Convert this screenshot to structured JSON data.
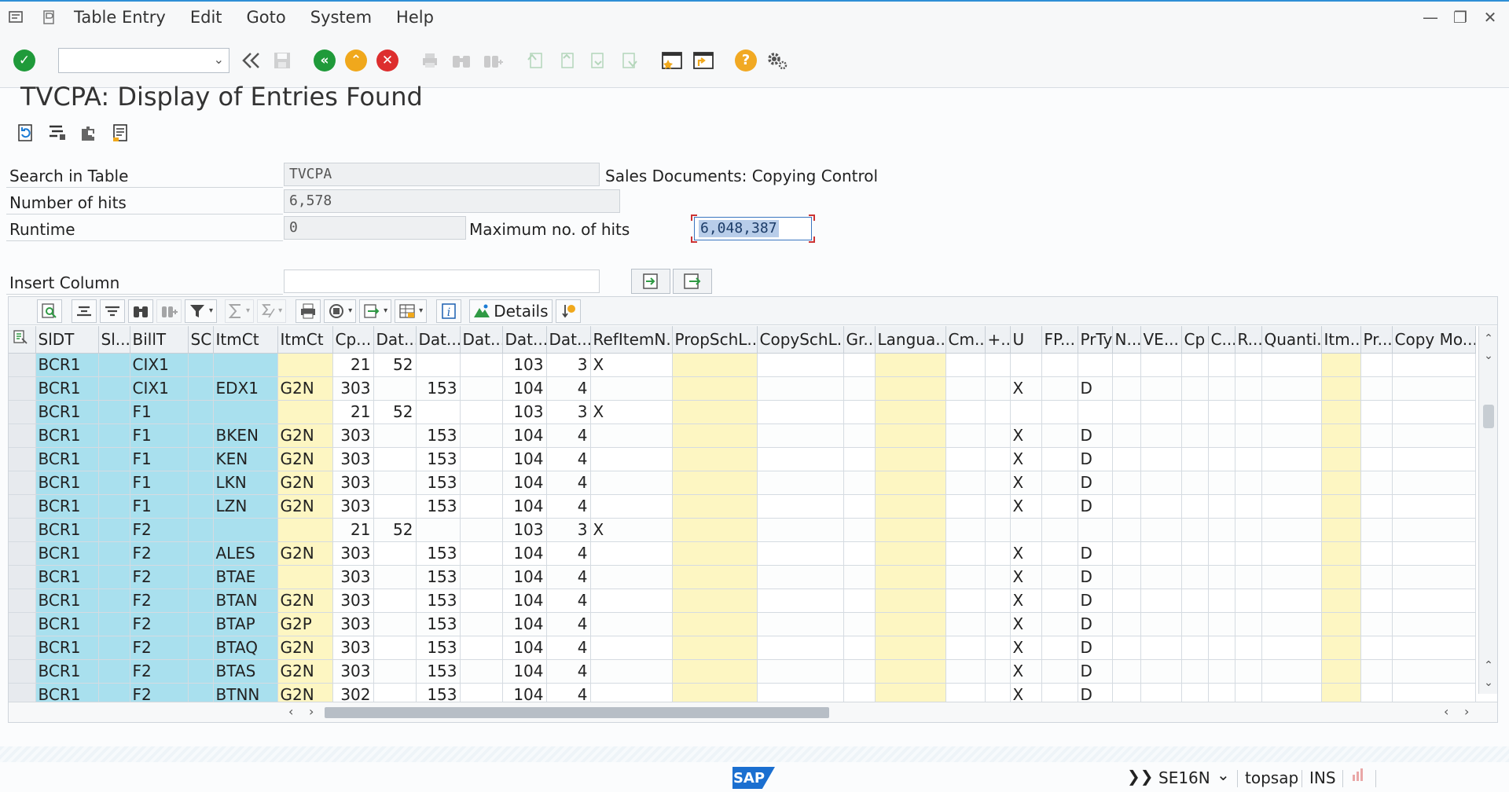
{
  "menu": {
    "items": [
      "Table Entry",
      "Edit",
      "Goto",
      "System",
      "Help"
    ],
    "window_controls": [
      "—",
      "❐",
      "✕"
    ]
  },
  "toolbar": {
    "command_field_value": ""
  },
  "page_title": "TVCPA: Display of Entries Found",
  "form": {
    "search_in_table_label": "Search in Table",
    "search_in_table_value": "TVCPA",
    "search_in_table_desc": "Sales Documents: Copying Control",
    "number_of_hits_label": "Number of hits",
    "number_of_hits_value": "6,578",
    "runtime_label": "Runtime",
    "runtime_value": "0",
    "max_hits_label": "Maximum no. of hits",
    "max_hits_value": "6,048,387",
    "insert_column_label": "Insert Column",
    "insert_column_value": ""
  },
  "alv": {
    "details_label": "Details"
  },
  "grid": {
    "columns": [
      "SlDT",
      "Sl...",
      "BillT",
      "SC",
      "ItmCt",
      "ItmCt",
      "Cp...",
      "Dat...",
      "Dat...",
      "Dat...",
      "Dat...",
      "Dat...",
      "RefItemN...",
      "PropSchL...",
      "CopySchL...",
      "Gr...",
      "Langua...",
      "Cm...",
      "+...",
      "U",
      "FP...",
      "PrTy",
      "N...",
      "VE...",
      "Cp",
      "C...",
      "R...",
      "Quanti...",
      "Itm...",
      "Pr...",
      "Copy Mo..."
    ],
    "rows": [
      [
        "BCR1",
        "",
        "CIX1",
        "",
        "",
        "",
        "21",
        "52",
        "",
        "",
        "103",
        "3",
        "X",
        "",
        "",
        "",
        "",
        "",
        "",
        "",
        "",
        "",
        "",
        "",
        "",
        "",
        "",
        "",
        "",
        "",
        ""
      ],
      [
        "BCR1",
        "",
        "CIX1",
        "",
        "EDX1",
        "G2N",
        "303",
        "",
        "153",
        "",
        "104",
        "4",
        "",
        "",
        "",
        "",
        "",
        "",
        "",
        "X",
        "",
        "D",
        "",
        "",
        "",
        "",
        "",
        "",
        "",
        "",
        ""
      ],
      [
        "BCR1",
        "",
        "F1",
        "",
        "",
        "",
        "21",
        "52",
        "",
        "",
        "103",
        "3",
        "X",
        "",
        "",
        "",
        "",
        "",
        "",
        "",
        "",
        "",
        "",
        "",
        "",
        "",
        "",
        "",
        "",
        "",
        ""
      ],
      [
        "BCR1",
        "",
        "F1",
        "",
        "BKEN",
        "G2N",
        "303",
        "",
        "153",
        "",
        "104",
        "4",
        "",
        "",
        "",
        "",
        "",
        "",
        "",
        "X",
        "",
        "D",
        "",
        "",
        "",
        "",
        "",
        "",
        "",
        "",
        ""
      ],
      [
        "BCR1",
        "",
        "F1",
        "",
        "KEN",
        "G2N",
        "303",
        "",
        "153",
        "",
        "104",
        "4",
        "",
        "",
        "",
        "",
        "",
        "",
        "",
        "X",
        "",
        "D",
        "",
        "",
        "",
        "",
        "",
        "",
        "",
        "",
        ""
      ],
      [
        "BCR1",
        "",
        "F1",
        "",
        "LKN",
        "G2N",
        "303",
        "",
        "153",
        "",
        "104",
        "4",
        "",
        "",
        "",
        "",
        "",
        "",
        "",
        "X",
        "",
        "D",
        "",
        "",
        "",
        "",
        "",
        "",
        "",
        "",
        ""
      ],
      [
        "BCR1",
        "",
        "F1",
        "",
        "LZN",
        "G2N",
        "303",
        "",
        "153",
        "",
        "104",
        "4",
        "",
        "",
        "",
        "",
        "",
        "",
        "",
        "X",
        "",
        "D",
        "",
        "",
        "",
        "",
        "",
        "",
        "",
        "",
        ""
      ],
      [
        "BCR1",
        "",
        "F2",
        "",
        "",
        "",
        "21",
        "52",
        "",
        "",
        "103",
        "3",
        "X",
        "",
        "",
        "",
        "",
        "",
        "",
        "",
        "",
        "",
        "",
        "",
        "",
        "",
        "",
        "",
        "",
        "",
        ""
      ],
      [
        "BCR1",
        "",
        "F2",
        "",
        "ALES",
        "G2N",
        "303",
        "",
        "153",
        "",
        "104",
        "4",
        "",
        "",
        "",
        "",
        "",
        "",
        "",
        "X",
        "",
        "D",
        "",
        "",
        "",
        "",
        "",
        "",
        "",
        "",
        ""
      ],
      [
        "BCR1",
        "",
        "F2",
        "",
        "BTAE",
        "",
        "303",
        "",
        "153",
        "",
        "104",
        "4",
        "",
        "",
        "",
        "",
        "",
        "",
        "",
        "X",
        "",
        "D",
        "",
        "",
        "",
        "",
        "",
        "",
        "",
        "",
        ""
      ],
      [
        "BCR1",
        "",
        "F2",
        "",
        "BTAN",
        "G2N",
        "303",
        "",
        "153",
        "",
        "104",
        "4",
        "",
        "",
        "",
        "",
        "",
        "",
        "",
        "X",
        "",
        "D",
        "",
        "",
        "",
        "",
        "",
        "",
        "",
        "",
        ""
      ],
      [
        "BCR1",
        "",
        "F2",
        "",
        "BTAP",
        "G2P",
        "303",
        "",
        "153",
        "",
        "104",
        "4",
        "",
        "",
        "",
        "",
        "",
        "",
        "",
        "X",
        "",
        "D",
        "",
        "",
        "",
        "",
        "",
        "",
        "",
        "",
        ""
      ],
      [
        "BCR1",
        "",
        "F2",
        "",
        "BTAQ",
        "G2N",
        "303",
        "",
        "153",
        "",
        "104",
        "4",
        "",
        "",
        "",
        "",
        "",
        "",
        "",
        "X",
        "",
        "D",
        "",
        "",
        "",
        "",
        "",
        "",
        "",
        "",
        ""
      ],
      [
        "BCR1",
        "",
        "F2",
        "",
        "BTAS",
        "G2N",
        "303",
        "",
        "153",
        "",
        "104",
        "4",
        "",
        "",
        "",
        "",
        "",
        "",
        "",
        "X",
        "",
        "D",
        "",
        "",
        "",
        "",
        "",
        "",
        "",
        "",
        ""
      ],
      [
        "BCR1",
        "",
        "F2",
        "",
        "BTNN",
        "G2N",
        "302",
        "",
        "153",
        "",
        "104",
        "4",
        "",
        "",
        "",
        "",
        "",
        "",
        "",
        "X",
        "",
        "D",
        "",
        "",
        "",
        "",
        "",
        "",
        "",
        "",
        ""
      ]
    ]
  },
  "status": {
    "transaction": "SE16N",
    "system": "topsap",
    "mode": "INS",
    "sap_logo": "SAP",
    "expand_glyph": "❯❯",
    "dropdown_glyph": "⌄"
  },
  "colors": {
    "key_column": "#a9e0ee",
    "highlight_column": "#fdf6c2",
    "accent_line": "#2e8fd6"
  }
}
